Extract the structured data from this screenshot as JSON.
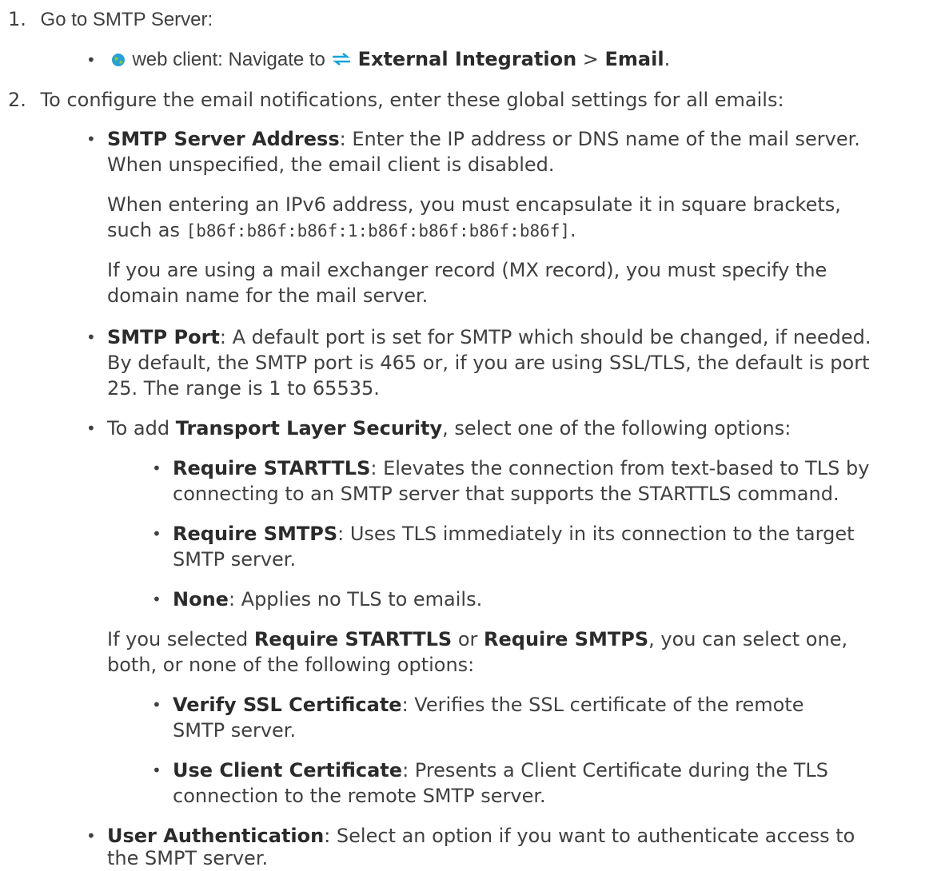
{
  "step1": {
    "num": "1.",
    "text": "Go to SMTP Server:",
    "sub": {
      "icon": "globe-icon",
      "client": "web client: Navigate to ",
      "nav_icon": "exchange-arrows-icon",
      "nav1": "External Integration",
      "sep": " > ",
      "nav2": "Email",
      "end": "."
    }
  },
  "step2": {
    "num": "2.",
    "text": "To configure the email notifications, enter these global settings for all emails:",
    "smtp_address": {
      "label": "SMTP Server Address",
      "line1": ": Enter the IP address or DNS name of the mail server.",
      "line2": "When unspecified, the email client is disabled.",
      "ipv6_line1": "When entering an IPv6 address, you must encapsulate it in square brackets,",
      "ipv6_such": "such as ",
      "ipv6_example": "[b86f:b86f:b86f:1:b86f:b86f:b86f:b86f]",
      "ipv6_end": ".",
      "mx_line1": "If you are using a mail exchanger record (MX record), you must specify the",
      "mx_line2": "domain name for the mail server."
    },
    "smtp_port": {
      "label": "SMTP Port",
      "line1": ": A default port is set for SMTP which should be changed, if needed.",
      "line2": "By default, the SMTP port is 465 or, if you are using SSL/TLS, the default is port",
      "line3": "25. The range is 1 to 65535."
    },
    "tls": {
      "pre": "To add ",
      "label": "Transport Layer Security",
      "post": ", select one of the following options:",
      "options": [
        {
          "label": "Require STARTTLS",
          "line1": ": Elevates the connection from text-based to TLS by",
          "line2": "connecting to an SMTP server that supports the STARTTLS command."
        },
        {
          "label": "Require SMTPS",
          "line1": ": Uses TLS immediately in its connection to the target",
          "line2": "SMTP server."
        },
        {
          "label": "None",
          "line1": ": Applies no TLS to emails.",
          "line2": ""
        }
      ],
      "if_pre": "If you selected ",
      "if_a": "Require STARTTLS",
      "if_or": " or ",
      "if_b": "Require SMTPS",
      "if_post": ", you can select one,",
      "if_line2": "both, or none of the following options:",
      "cert_options": [
        {
          "label": "Verify SSL Certificate",
          "line1": ": Verifies the SSL certificate of the remote",
          "line2": "SMTP server."
        },
        {
          "label": "Use Client Certificate",
          "line1": ": Presents a Client Certificate during the TLS",
          "line2": "connection to the remote SMTP server."
        }
      ]
    },
    "user_auth": {
      "label": "User Authentication",
      "line1": ": Select an option if you want to authenticate access to",
      "line2": "the SMPT server."
    }
  },
  "bullet_char": "•",
  "colors": {
    "text": "#404040",
    "bold": "#2b2b2b",
    "globe": "#2a9fd6",
    "arrows": "#1aa3d9"
  }
}
